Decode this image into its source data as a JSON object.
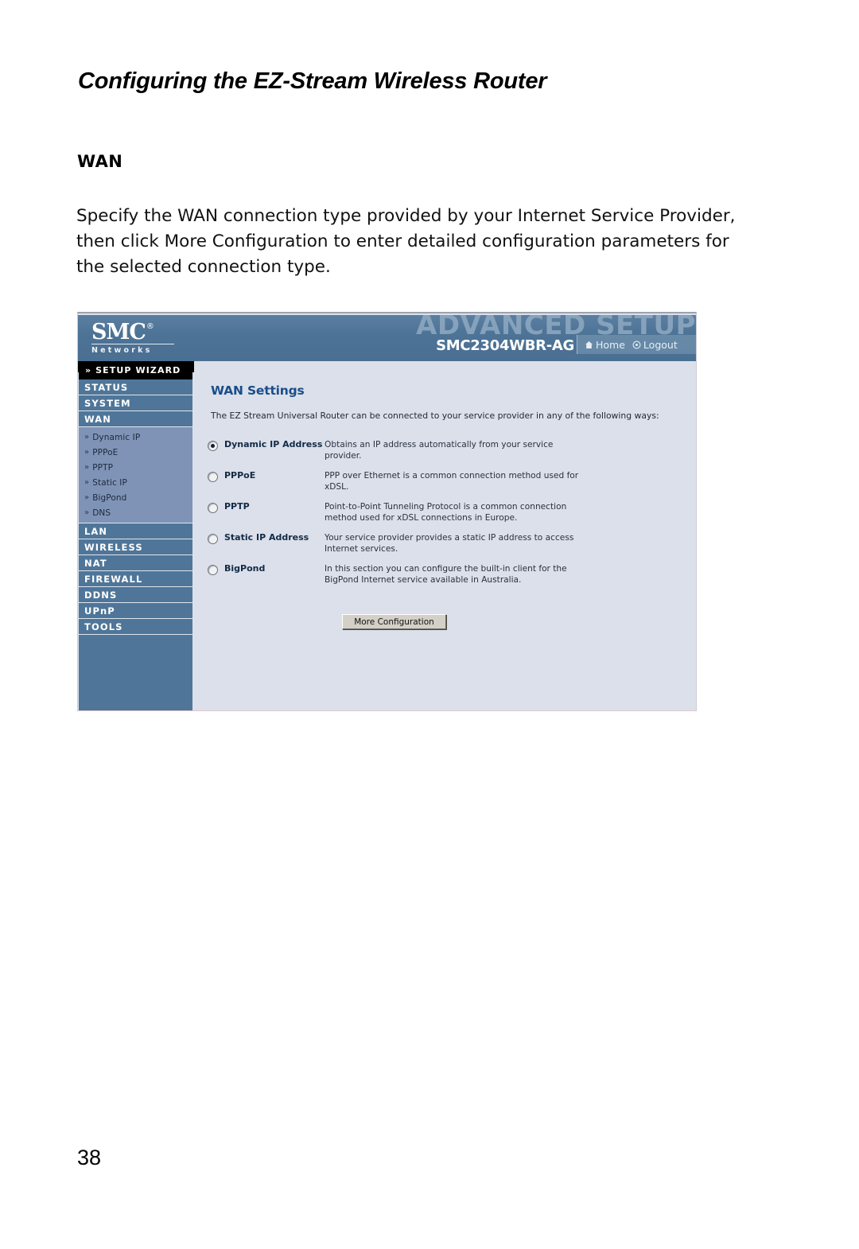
{
  "document": {
    "title": "Configuring the EZ-Stream Wireless Router",
    "section_heading": "WAN",
    "body_text": "Specify the WAN connection type provided by your Internet Service Provider, then click More Configuration to enter detailed configuration parameters for the selected connection type.",
    "page_number": "38"
  },
  "router_ui": {
    "header": {
      "logo_text": "SMC",
      "logo_registered": "®",
      "logo_subtitle": "Networks",
      "watermark": "ADVANCED SETUP",
      "model": "SMC2304WBR-AG",
      "links": [
        {
          "label": "Home",
          "icon": "home-icon"
        },
        {
          "label": "Logout",
          "icon": "logout-icon"
        }
      ]
    },
    "sidebar": {
      "wizard_label": "» SETUP WIZARD",
      "items": [
        {
          "label": "STATUS"
        },
        {
          "label": "SYSTEM"
        },
        {
          "label": "WAN"
        }
      ],
      "wan_subitems": [
        {
          "label": "Dynamic IP"
        },
        {
          "label": "PPPoE"
        },
        {
          "label": "PPTP"
        },
        {
          "label": "Static IP"
        },
        {
          "label": "BigPond"
        },
        {
          "label": "DNS"
        }
      ],
      "items_after": [
        {
          "label": "LAN"
        },
        {
          "label": "WIRELESS"
        },
        {
          "label": "NAT"
        },
        {
          "label": "FIREWALL"
        },
        {
          "label": "DDNS"
        },
        {
          "label": "UPnP"
        },
        {
          "label": "TOOLS"
        }
      ]
    },
    "main": {
      "title": "WAN Settings",
      "intro": "The EZ Stream Universal Router can be connected to your service provider in any of the following ways:",
      "options": [
        {
          "label": "Dynamic IP Address",
          "description": "Obtains an IP address automatically from your service provider.",
          "selected": true
        },
        {
          "label": "PPPoE",
          "description": "PPP over Ethernet is a common connection method used for xDSL.",
          "selected": false
        },
        {
          "label": "PPTP",
          "description": "Point-to-Point Tunneling Protocol is a common connection method used for xDSL connections in Europe.",
          "selected": false
        },
        {
          "label": "Static IP Address",
          "description": "Your service provider provides a static IP address to access Internet services.",
          "selected": false
        },
        {
          "label": "BigPond",
          "description": "In this section you can configure the built-in client for the BigPond Internet service available in Australia.",
          "selected": false
        }
      ],
      "more_config_label": "More Configuration"
    }
  },
  "colors": {
    "header_blue": "#4d7396",
    "sidebar_blue": "#4f7699",
    "submenu_blue": "#7f93b6",
    "content_bg": "#dbe0ea",
    "title_blue": "#1a4e8a",
    "watermark": "#8fa9c2"
  }
}
